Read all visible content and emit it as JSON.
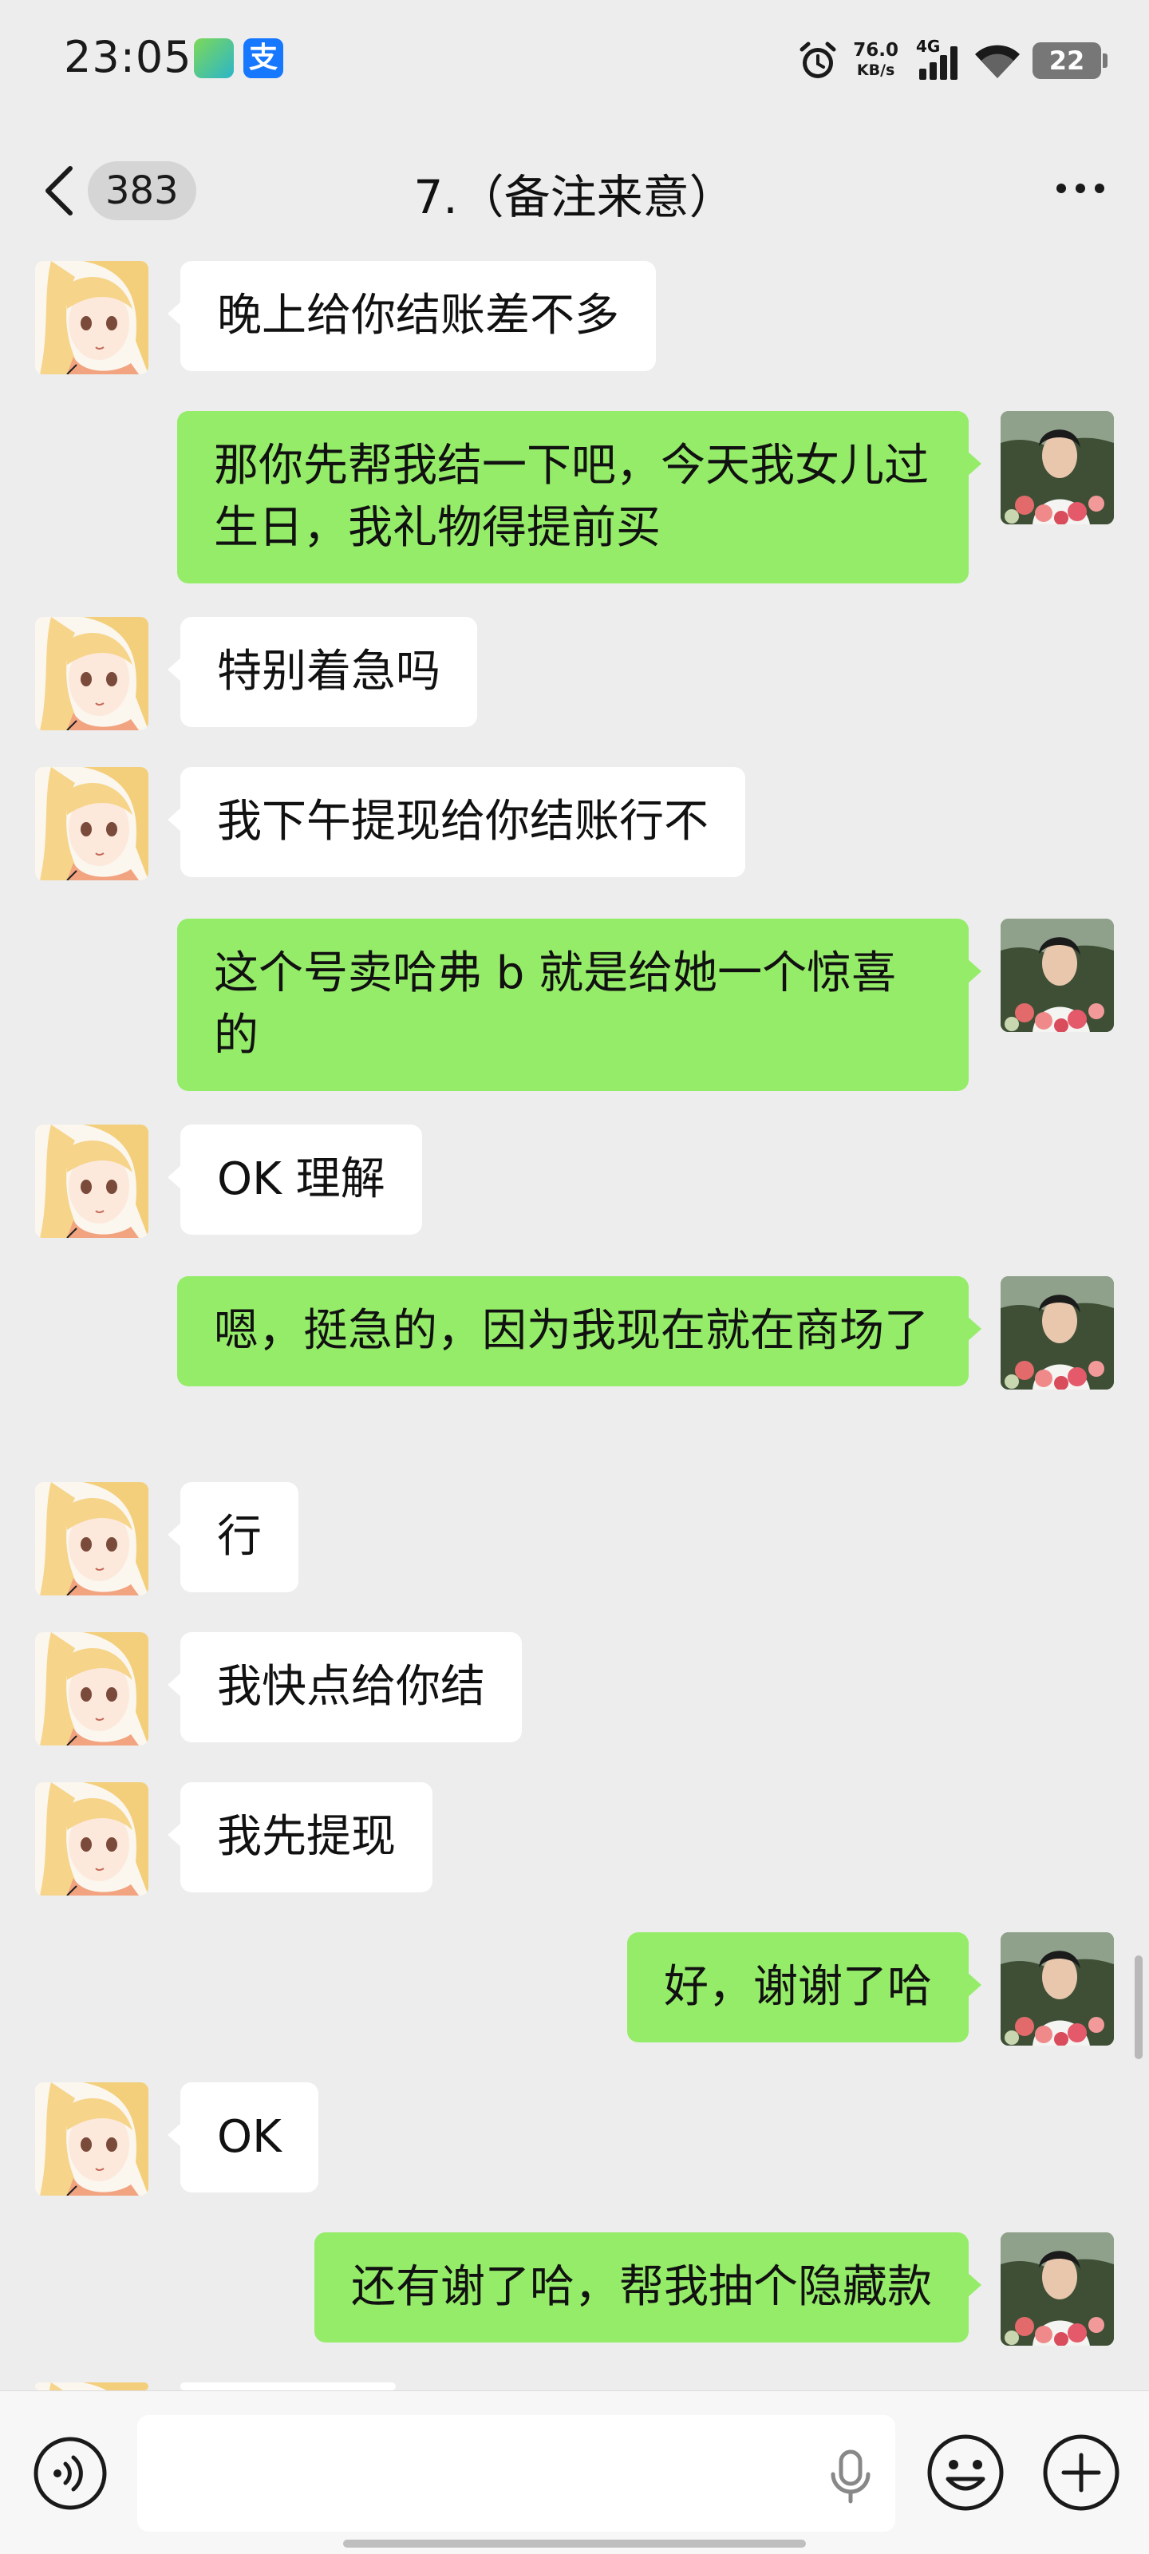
{
  "status_bar": {
    "time": "23:05",
    "app_icons": [
      "wifi-tool-icon",
      "alipay-icon"
    ],
    "alipay_glyph": "支",
    "net_speed_value": "76.0",
    "net_speed_unit": "KB/s",
    "network_type": "4G",
    "battery": "22"
  },
  "header": {
    "back_badge": "383",
    "title": "7.（备注来意）"
  },
  "messages": [
    {
      "side": "left",
      "text": "晚上给你结账差不多"
    },
    {
      "side": "right",
      "text": "那你先帮我结一下吧，今天我女儿过生日，我礼物得提前买"
    },
    {
      "side": "left",
      "text": "特别着急吗"
    },
    {
      "side": "left",
      "text": "我下午提现给你结账行不"
    },
    {
      "side": "right",
      "text": "这个号卖哈弗 b 就是给她一个惊喜的"
    },
    {
      "side": "left",
      "text": "OK 理解"
    },
    {
      "side": "right",
      "text": "嗯，挺急的，因为我现在就在商场了"
    },
    {
      "side": "left",
      "text": "行"
    },
    {
      "side": "left",
      "text": "我快点给你结"
    },
    {
      "side": "left",
      "text": "我先提现"
    },
    {
      "side": "right",
      "text": "好，谢谢了哈"
    },
    {
      "side": "left",
      "text": "OK"
    },
    {
      "side": "right",
      "text": "还有谢了哈，帮我抽个隐藏款"
    }
  ],
  "input_bar": {
    "text_value": ""
  },
  "colors": {
    "background": "#ededed",
    "bubble_self": "#95ec69",
    "bubble_other": "#ffffff"
  }
}
